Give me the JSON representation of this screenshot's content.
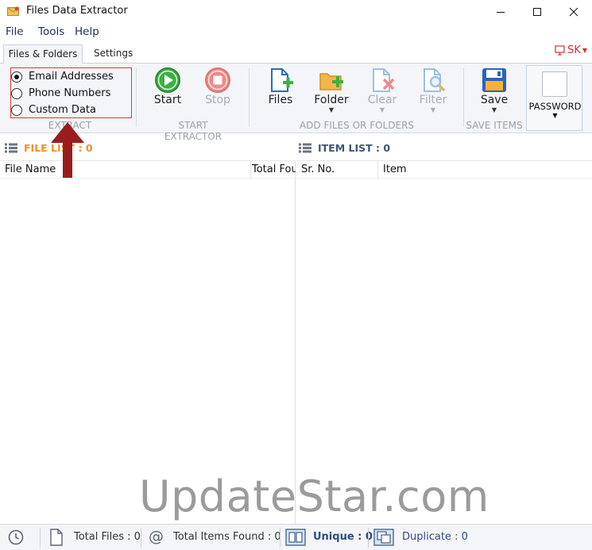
{
  "window": {
    "title": "Files Data Extractor"
  },
  "menu": [
    "File",
    "Tools",
    "Help"
  ],
  "tabs": {
    "active": "Files & Folders",
    "settings": "Settings"
  },
  "user": {
    "initials": "SK"
  },
  "extract": {
    "options": [
      "Email Addresses",
      "Phone Numbers",
      "Custom Data"
    ],
    "selected": "Email Addresses",
    "label": "EXTRACT"
  },
  "start_extractor": {
    "start": "Start",
    "stop": "Stop",
    "label": "START EXTRACTOR"
  },
  "add_files": {
    "files": "Files",
    "folder": "Folder",
    "clear": "Clear",
    "filter": "Filter",
    "label": "ADD FILES OR FOLDERS"
  },
  "save_items": {
    "save": "Save",
    "label": "SAVE ITEMS"
  },
  "password": {
    "label": "PASSWORD"
  },
  "file_list": {
    "title": "FILE LIST : 0",
    "columns": [
      "File Name",
      "Total Fou"
    ]
  },
  "item_list": {
    "title": "ITEM LIST : 0",
    "columns": [
      "Sr. No.",
      "Item"
    ]
  },
  "status": {
    "total_files": "Total Files : 0",
    "total_items": "Total Items Found : 0",
    "unique": "Unique : 0",
    "duplicate": "Duplicate : 0"
  },
  "watermark": "UpdateStar.com",
  "colors": {
    "accent_red": "#d53a3a",
    "arrow": "#9b1c1c",
    "file_list_orange": "#f0902b",
    "start_green": "#3cb043",
    "stop_red": "#f08a8a"
  }
}
